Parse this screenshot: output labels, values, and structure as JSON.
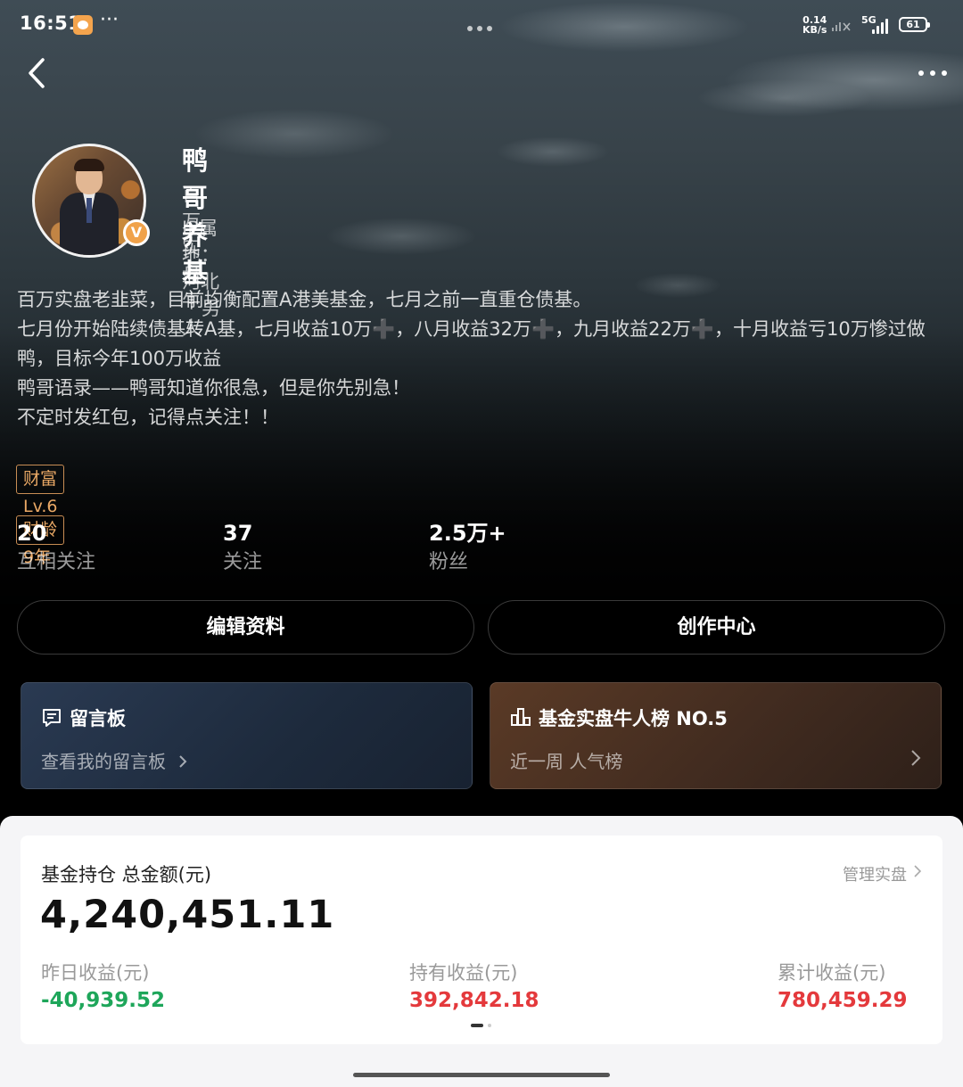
{
  "status_bar": {
    "time": "16:51",
    "network_speed_value": "0.14",
    "network_speed_unit": "KB/s",
    "signal_label": "5G",
    "battery": "61",
    "icons": [
      "app-notification-icon",
      "more-dots-icon",
      "wifi-off-icon",
      "signal-icon",
      "battery-icon"
    ]
  },
  "nav": {
    "back_icon": "chevron-left-icon",
    "more_icon": "more-horizontal-icon"
  },
  "profile": {
    "name": "鸭哥养基",
    "title": "百万实盘牛人",
    "ip_location": "IP属地：河北",
    "gender": "男",
    "badge": "V"
  },
  "bio": [
    "百万实盘老韭菜，目前均衡配置A港美基金，七月之前一直重仓债基。",
    "七月份开始陆续债基转A基，七月收益10万➕，八月收益32万➕，九月收益22万➕，十月收益亏10万惨过做鸭，目标今年100万收益",
    "鸭哥语录——鸭哥知道你很急，但是你先别急！",
    "不定时发红包，记得点关注！！"
  ],
  "tags": [
    "财富Lv.6",
    "财龄9年"
  ],
  "stats": [
    {
      "num": "20",
      "label": "互相关注"
    },
    {
      "num": "37",
      "label": "关注"
    },
    {
      "num": "2.5万+",
      "label": "粉丝"
    }
  ],
  "buttons": {
    "edit": "编辑资料",
    "creator": "创作中心"
  },
  "cards": {
    "message_board": {
      "title": "留言板",
      "subtitle": "查看我的留言板"
    },
    "ranking": {
      "title": "基金实盘牛人榜 NO.5",
      "subtitle": "近一周 人气榜"
    }
  },
  "fund": {
    "title": "基金持仓 总金额(元)",
    "manage": "管理实盘",
    "total": "4,240,451.11",
    "columns": [
      {
        "label": "昨日收益(元)",
        "value": "-40,939.52",
        "sign": "neg"
      },
      {
        "label": "持有收益(元)",
        "value": "392,842.18",
        "sign": "pos"
      },
      {
        "label": "累计收益(元)",
        "value": "780,459.29",
        "sign": "pos"
      }
    ]
  },
  "colors": {
    "accent_orange": "#e9a865",
    "gain_red": "#e4393c",
    "loss_green": "#1ea65a"
  }
}
